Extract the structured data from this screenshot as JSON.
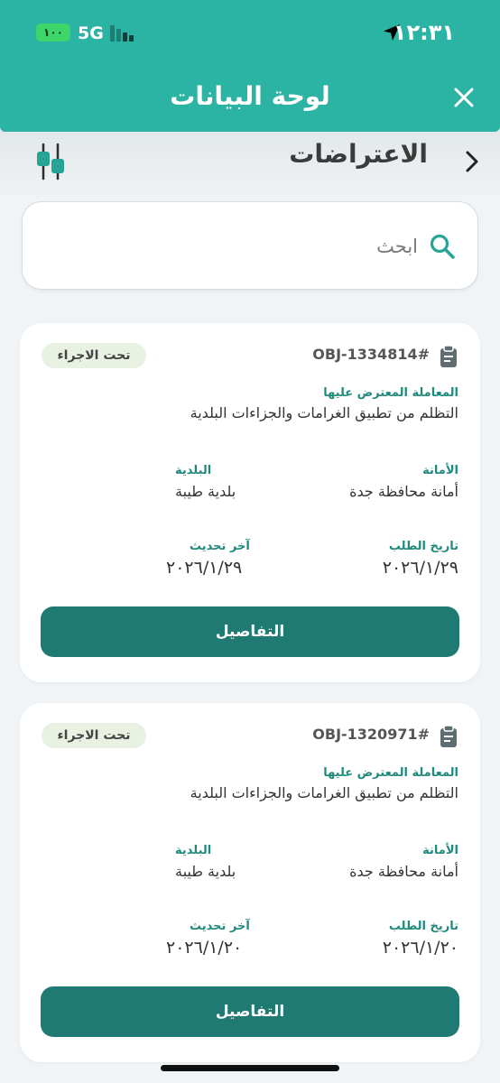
{
  "status_bar": {
    "time": "١٢:٣١",
    "network": "5G",
    "battery": "١٠٠",
    "battery_color": "#3cd66a"
  },
  "header": {
    "title": "لوحة البيانات",
    "close_icon": "close-icon",
    "background_color": "#2bb3a3"
  },
  "section": {
    "title": "الاعتراضات",
    "back_icon": "chevron-right-icon",
    "filter_icon": "sliders-icon"
  },
  "search": {
    "placeholder": "ابحث",
    "value": ""
  },
  "accent_color": "#1f7a73",
  "cards": [
    {
      "id": "OBJ-1334814#",
      "status": "تحت الاجراء",
      "transaction_label": "المعاملة المعترض عليها",
      "transaction_value": "التظلم من تطبيق الغرامات والجزاءات البلدية",
      "amana_label": "الأمانة",
      "amana_value": "أمانة محافظة جدة",
      "baladiya_label": "البلدية",
      "baladiya_value": "بلدية طيبة",
      "request_date_label": "تاريخ الطلب",
      "request_date": "٢٠٢٦/١/٢٩",
      "last_update_label": "آخر تحديث",
      "last_update": "٢٠٢٦/١/٢٩",
      "details_label": "التفاصيل"
    },
    {
      "id": "OBJ-1320971#",
      "status": "تحت الاجراء",
      "transaction_label": "المعاملة المعترض عليها",
      "transaction_value": "التظلم من تطبيق الغرامات والجزاءات البلدية",
      "amana_label": "الأمانة",
      "amana_value": "أمانة محافظة جدة",
      "baladiya_label": "البلدية",
      "baladiya_value": "بلدية طيبة",
      "request_date_label": "تاريخ الطلب",
      "request_date": "٢٠٢٦/١/٢٠",
      "last_update_label": "آخر تحديث",
      "last_update": "٢٠٢٦/١/٢٠",
      "details_label": "التفاصيل"
    }
  ]
}
